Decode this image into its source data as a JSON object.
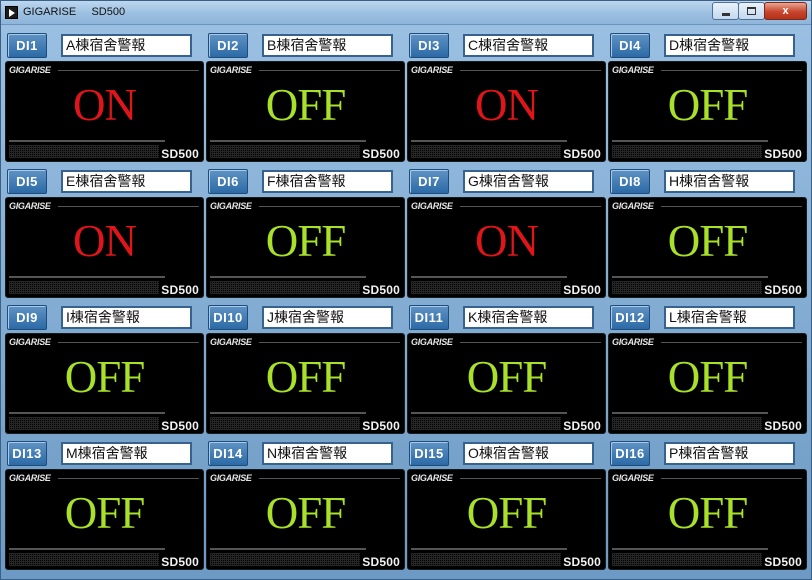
{
  "window": {
    "title": "GIGARISE     SD500",
    "minimize_label": "",
    "maximize_label": "",
    "close_label": "x",
    "icon": "app-icon"
  },
  "panel_brand": "GIGARISE",
  "panel_model": "SD500",
  "colors": {
    "on": "#e0151a",
    "off": "#a8e02a"
  },
  "channels": [
    {
      "di": "DI1",
      "name": "A棟宿舍警報",
      "status": "ON"
    },
    {
      "di": "DI2",
      "name": "B棟宿舍警報",
      "status": "OFF"
    },
    {
      "di": "DI3",
      "name": "C棟宿舍警報",
      "status": "ON"
    },
    {
      "di": "DI4",
      "name": "D棟宿舍警報",
      "status": "OFF"
    },
    {
      "di": "DI5",
      "name": "E棟宿舍警報",
      "status": "ON"
    },
    {
      "di": "DI6",
      "name": "F棟宿舍警報",
      "status": "OFF"
    },
    {
      "di": "DI7",
      "name": "G棟宿舍警報",
      "status": "ON"
    },
    {
      "di": "DI8",
      "name": "H棟宿舍警報",
      "status": "OFF"
    },
    {
      "di": "DI9",
      "name": "I棟宿舍警報",
      "status": "OFF"
    },
    {
      "di": "DI10",
      "name": "J棟宿舍警報",
      "status": "OFF"
    },
    {
      "di": "DI11",
      "name": "K棟宿舍警報",
      "status": "OFF"
    },
    {
      "di": "DI12",
      "name": "L棟宿舍警報",
      "status": "OFF"
    },
    {
      "di": "DI13",
      "name": "M棟宿舍警報",
      "status": "OFF"
    },
    {
      "di": "DI14",
      "name": "N棟宿舍警報",
      "status": "OFF"
    },
    {
      "di": "DI15",
      "name": "O棟宿舍警報",
      "status": "OFF"
    },
    {
      "di": "DI16",
      "name": "P棟宿舍警報",
      "status": "OFF"
    }
  ]
}
